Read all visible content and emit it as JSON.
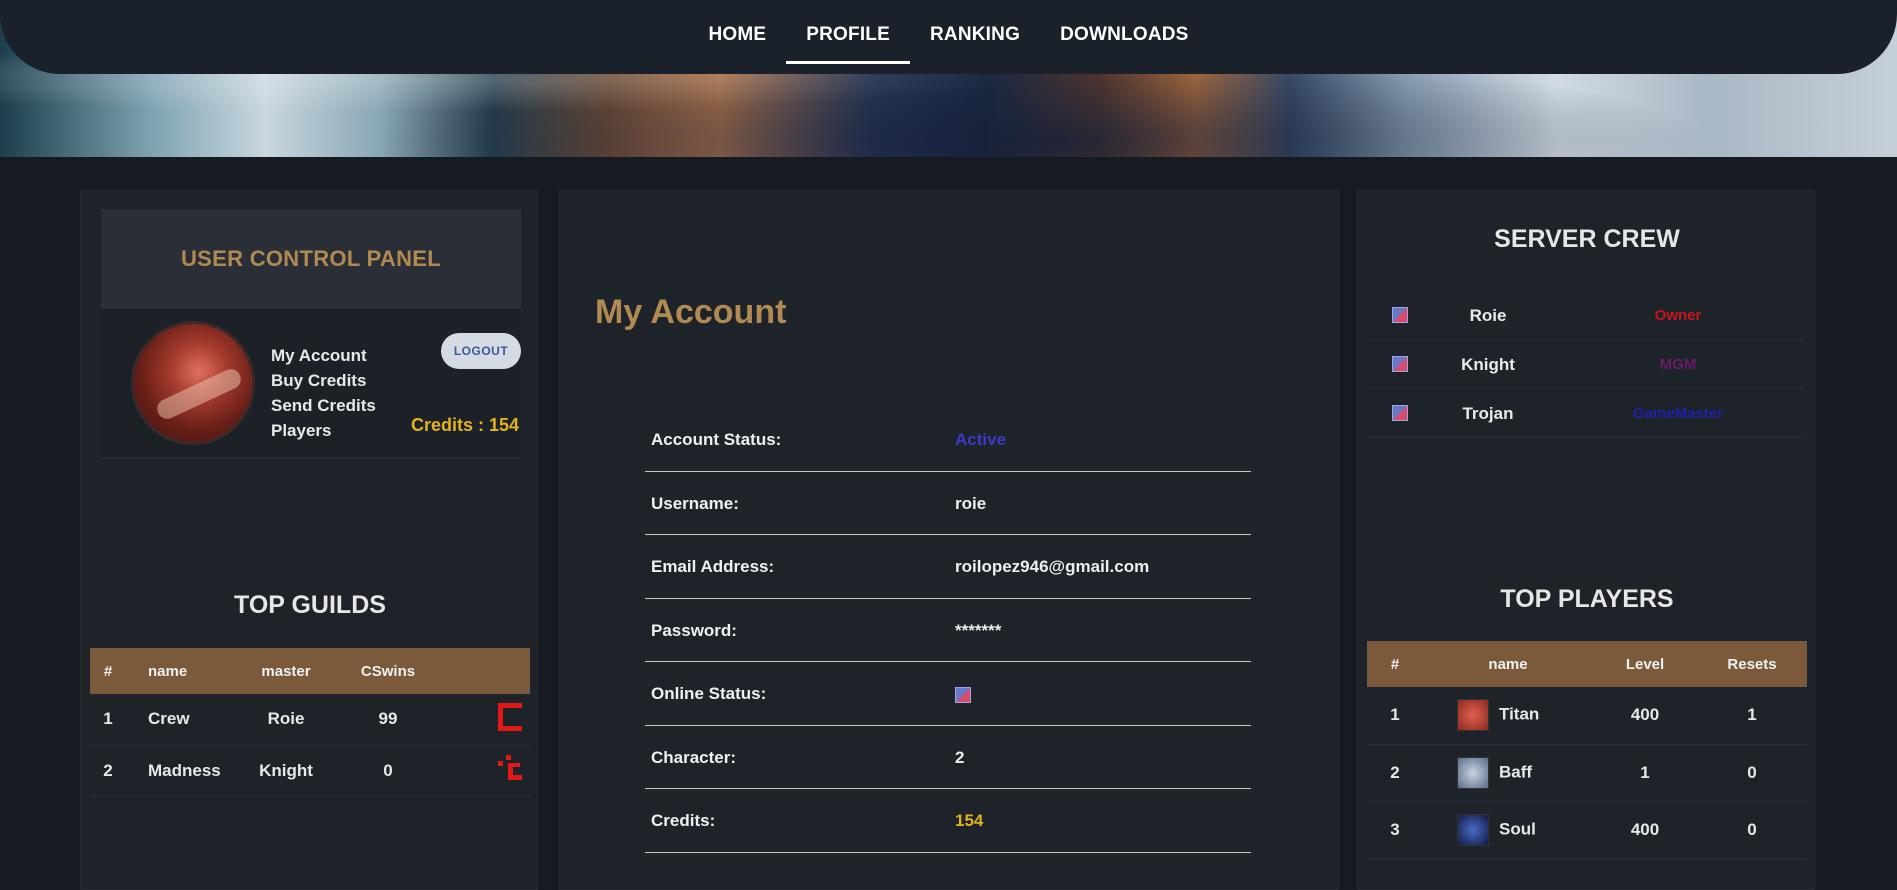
{
  "nav": {
    "items": [
      {
        "label": "HOME",
        "active": false
      },
      {
        "label": "PROFILE",
        "active": true
      },
      {
        "label": "RANKING",
        "active": false
      },
      {
        "label": "DOWNLOADS",
        "active": false
      }
    ]
  },
  "ucp": {
    "title": "USER CONTROL PANEL",
    "links": [
      "My Account",
      "Buy Credits",
      "Send Credits",
      "Players"
    ],
    "logout_label": "LOGOUT",
    "credits_label": "Credits : 154"
  },
  "top_guilds": {
    "title": "TOP GUILDS",
    "headers": [
      "#",
      "name",
      "master",
      "CSwins",
      ""
    ],
    "rows": [
      {
        "rank": "1",
        "name": "Crew",
        "master": "Roie",
        "cswins": "99"
      },
      {
        "rank": "2",
        "name": "Madness",
        "master": "Knight",
        "cswins": "0"
      }
    ]
  },
  "account": {
    "title": "My Account",
    "rows": [
      {
        "label": "Account Status:",
        "value": "Active"
      },
      {
        "label": "Username:",
        "value": "roie"
      },
      {
        "label": "Email Address:",
        "value": "roilopez946@gmail.com"
      },
      {
        "label": "Password:",
        "value": "*******"
      },
      {
        "label": "Online Status:",
        "value": ""
      },
      {
        "label": "Character:",
        "value": "2"
      },
      {
        "label": "Credits:",
        "value": "154"
      }
    ]
  },
  "server_crew": {
    "title": "SERVER CREW",
    "members": [
      {
        "name": "Roie",
        "role": "Owner",
        "color": "#c8141e"
      },
      {
        "name": "Knight",
        "role": "MGM",
        "color": "#6a1a6a"
      },
      {
        "name": "Trojan",
        "role": "GameMaster",
        "color": "#2020a8"
      }
    ]
  },
  "top_players": {
    "title": "TOP PLAYERS",
    "headers": [
      "#",
      "name",
      "Level",
      "Resets"
    ],
    "rows": [
      {
        "rank": "1",
        "name": "Titan",
        "level": "400",
        "resets": "1"
      },
      {
        "rank": "2",
        "name": "Baff",
        "level": "1",
        "resets": "0"
      },
      {
        "rank": "3",
        "name": "Soul",
        "level": "400",
        "resets": "0"
      }
    ]
  },
  "colors": {
    "accent_gold": "#b08a52",
    "credits_yellow": "#e1b31e",
    "table_header": "#7a5a3a",
    "status_active": "#3a3ac8"
  }
}
